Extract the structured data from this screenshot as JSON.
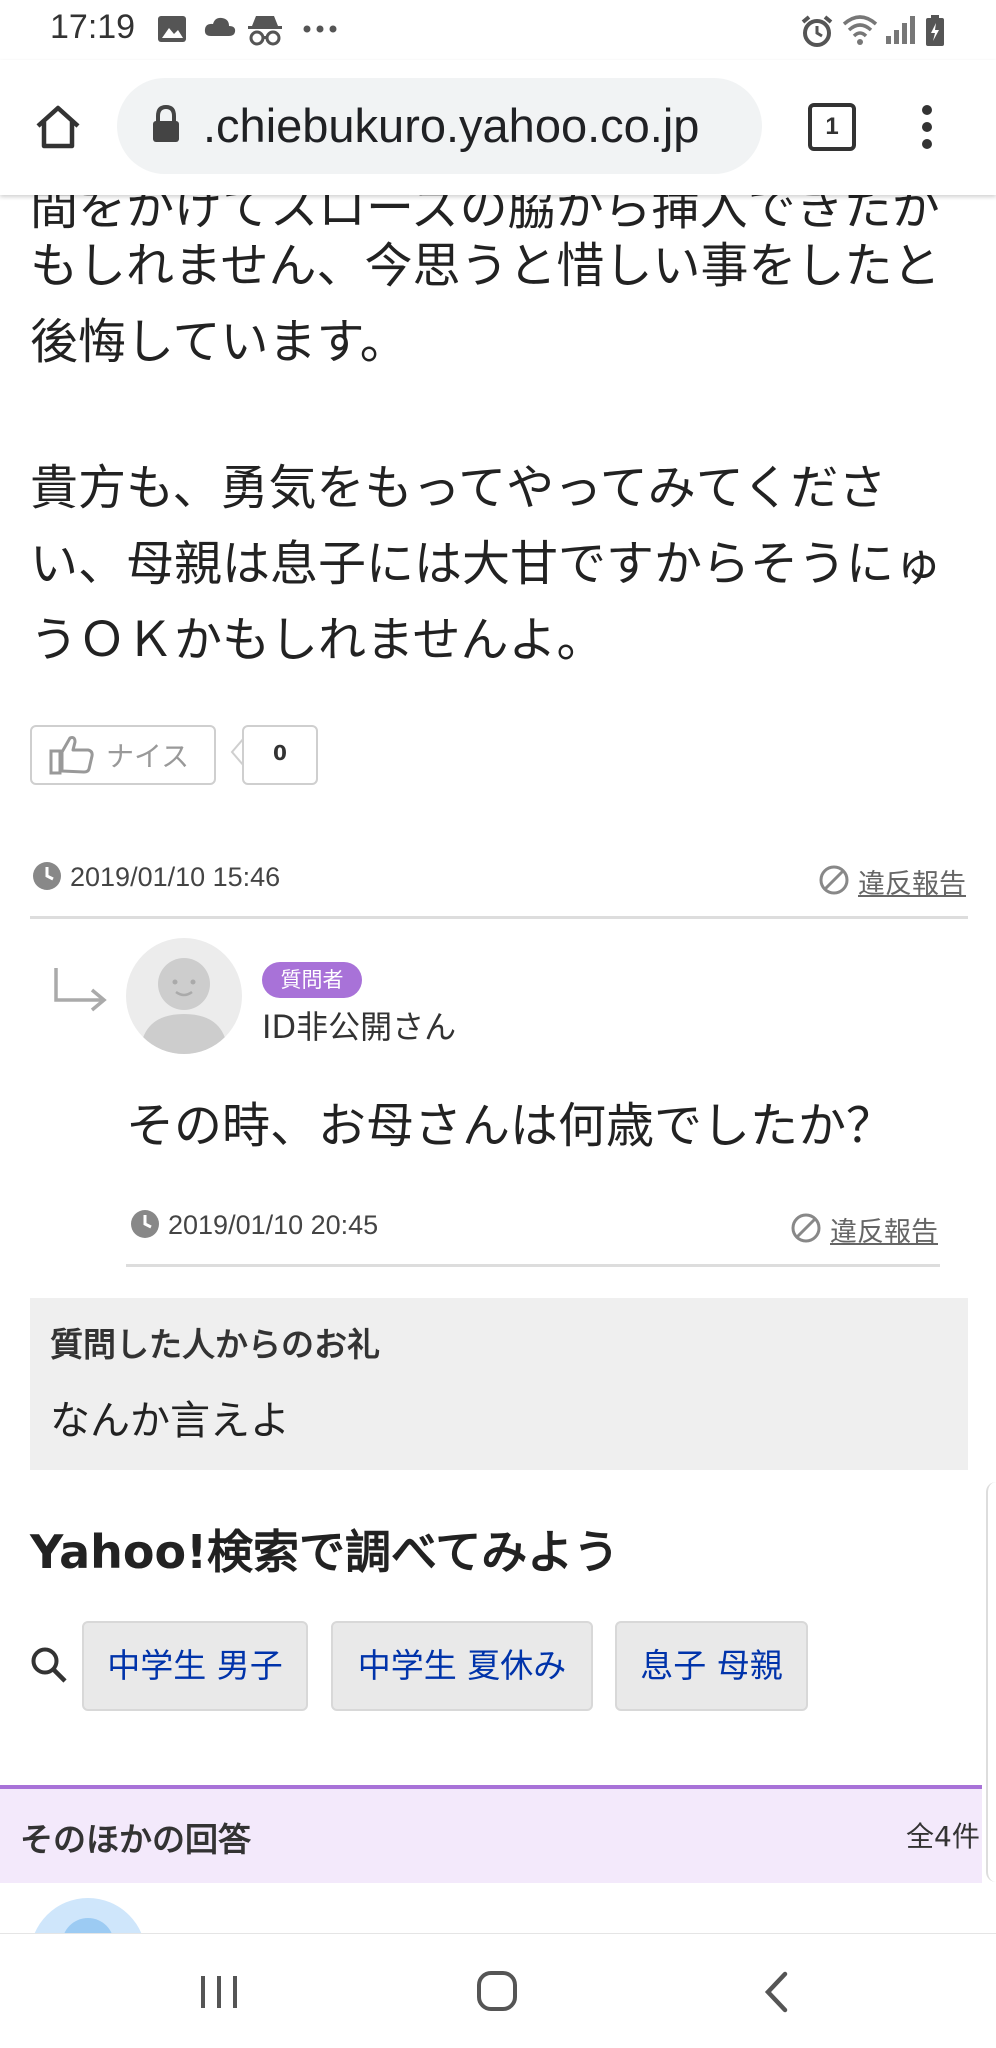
{
  "status_bar": {
    "time": "17:19",
    "icons": [
      "image-icon",
      "cloud-icon",
      "incognito-icon",
      "more-icon",
      "alarm-icon",
      "wifi-icon",
      "signal-icon",
      "battery-icon"
    ]
  },
  "browser": {
    "url": ".chiebukuro.yahoo.co.jp",
    "tab_count": "1",
    "icons": [
      "home-icon",
      "lock-icon",
      "tabs-icon",
      "menu-icon"
    ]
  },
  "answer": {
    "partial_line": "間をかけてスローズの脇から挿入できたか",
    "lines": [
      "もしれません、今思うと惜しい事をしたと",
      "後悔しています。",
      "",
      "貴方も、勇気をもってやってみてくださ",
      "い、母親は息子には大甘ですからそうにゅ",
      "うＯＫかもしれませんよ。"
    ],
    "nice_label": "ナイス",
    "nice_count": "0",
    "timestamp": "2019/01/10 15:46",
    "report_label": "違反報告"
  },
  "reply": {
    "badge": "質問者",
    "author": "ID非公開さん",
    "text": "その時、お母さんは何歳でしたか？",
    "timestamp": "2019/01/10 20:45",
    "report_label": "違反報告"
  },
  "thanks": {
    "heading": "質問した人からのお礼",
    "text": "なんか言えよ"
  },
  "search": {
    "heading": "Yahoo!検索で調べてみよう",
    "chips": [
      "中学生 男子",
      "中学生 夏休み",
      "息子 母親"
    ]
  },
  "other_answers": {
    "heading": "そのほかの回答",
    "count": "全4件"
  },
  "nav_bar": {
    "icons": [
      "recent-apps-icon",
      "home-button-icon",
      "back-icon"
    ]
  },
  "colors": {
    "accent_purple": "#a872d8",
    "link_blue": "#0033aa",
    "panel_gray": "#efefef"
  }
}
